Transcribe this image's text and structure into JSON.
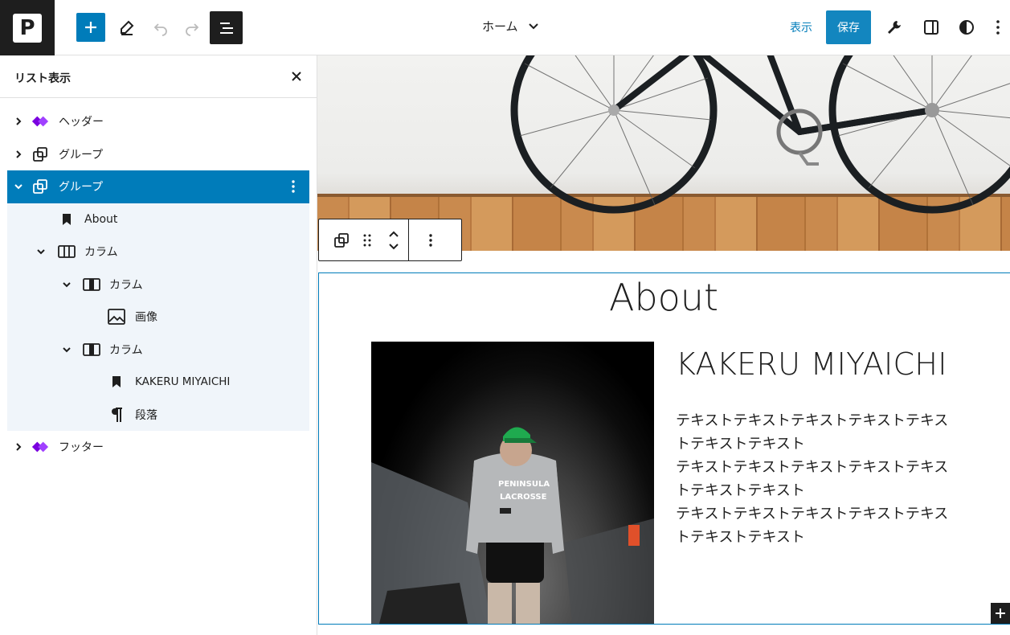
{
  "topbar": {
    "logo_letter": "P",
    "doc_title": "ホーム",
    "view_label": "表示",
    "save_label": "保存"
  },
  "sidebar": {
    "title": "リスト表示",
    "items": [
      {
        "label": "ヘッダー",
        "icon": "template-part-icon"
      },
      {
        "label": "グループ",
        "icon": "group-icon"
      },
      {
        "label": "グループ",
        "icon": "group-icon",
        "selected": true
      },
      {
        "label": "About",
        "icon": "bookmark-icon"
      },
      {
        "label": "カラム",
        "icon": "columns-icon"
      },
      {
        "label": "カラム",
        "icon": "column-icon"
      },
      {
        "label": "画像",
        "icon": "image-icon"
      },
      {
        "label": "カラム",
        "icon": "column-icon"
      },
      {
        "label": "KAKERU MIYAICHI",
        "icon": "bookmark-icon"
      },
      {
        "label": "段落",
        "icon": "paragraph-icon"
      },
      {
        "label": "フッター",
        "icon": "template-part-icon"
      }
    ]
  },
  "canvas": {
    "heading": "About",
    "name": "KAKERU MIYAICHI",
    "paragraph_lines": [
      "テキストテキストテキストテキストテキス",
      "トテキストテキスト",
      "テキストテキストテキストテキストテキス",
      "トテキストテキスト",
      "テキストテキストテキストテキストテキス",
      "トテキストテキスト"
    ],
    "photo_text": [
      "PENINSULA",
      "LACROSSE"
    ]
  },
  "colors": {
    "accent": "#007cba",
    "selected_bg": "#007cba",
    "child_bg": "#f0f5fa",
    "template_part": "#7a00df"
  }
}
